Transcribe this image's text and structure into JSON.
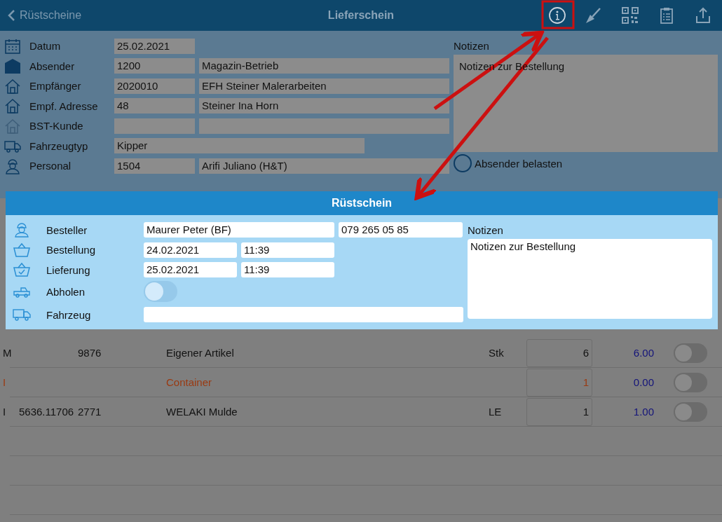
{
  "nav": {
    "back": "Rüstscheine",
    "title": "Lieferschein"
  },
  "form": {
    "rows": [
      {
        "label": "Datum",
        "kind": "single",
        "values": [
          "25.02.2021"
        ]
      },
      {
        "label": "Absender",
        "kind": "pair",
        "values": [
          "1200",
          "Magazin-Betrieb"
        ]
      },
      {
        "label": "Empfänger",
        "kind": "pair",
        "values": [
          "2020010",
          "EFH Steiner Malerarbeiten"
        ]
      },
      {
        "label": "Empf. Adresse",
        "kind": "pair",
        "values": [
          "48",
          "Steiner Ina Horn"
        ]
      },
      {
        "label": "BST-Kunde",
        "kind": "pair",
        "values": []
      },
      {
        "label": "Fahrzeugtyp",
        "kind": "wide",
        "values": [
          "Kipper"
        ]
      },
      {
        "label": "Personal",
        "kind": "pair",
        "values": [
          "1504",
          "Arifi Juliano (H&T)"
        ]
      }
    ],
    "notes_label": "Notizen",
    "notes": "Notizen zur Bestellung",
    "charge_sender": {
      "label": "Absender belasten",
      "checked": false
    }
  },
  "table": {
    "rows": [
      {
        "kind": "normal",
        "cells": [
          "M",
          "",
          "9876",
          "Eigener Artikel",
          "Stk"
        ],
        "qty": "6",
        "price": "6.00",
        "on": false
      },
      {
        "kind": "marker",
        "cells": [
          "I",
          "",
          "",
          "Container",
          ""
        ],
        "qty": "1",
        "price": "0.00",
        "on": false
      },
      {
        "kind": "normal",
        "cells": [
          "I",
          "5636.11706",
          "2771",
          "WELAKI Mulde",
          "LE"
        ],
        "qty": "1",
        "price": "1.00",
        "on": false
      }
    ]
  },
  "popup": {
    "title": "Rüstschein",
    "rows": [
      {
        "label": "Besteller",
        "kind": "name_phone",
        "values": [
          "Maurer Peter (BF)",
          "079 265 05 85"
        ]
      },
      {
        "label": "Bestellung",
        "kind": "date_time",
        "values": [
          "24.02.2021",
          "11:39"
        ]
      },
      {
        "label": "Lieferung",
        "kind": "date_time",
        "values": [
          "25.02.2021",
          "11:39"
        ]
      },
      {
        "label": "Abholen",
        "kind": "toggle",
        "on": false
      },
      {
        "label": "Fahrzeug",
        "kind": "wide",
        "values": []
      }
    ],
    "notes_label": "Notizen",
    "notes": "Notizen zur Bestellung"
  }
}
